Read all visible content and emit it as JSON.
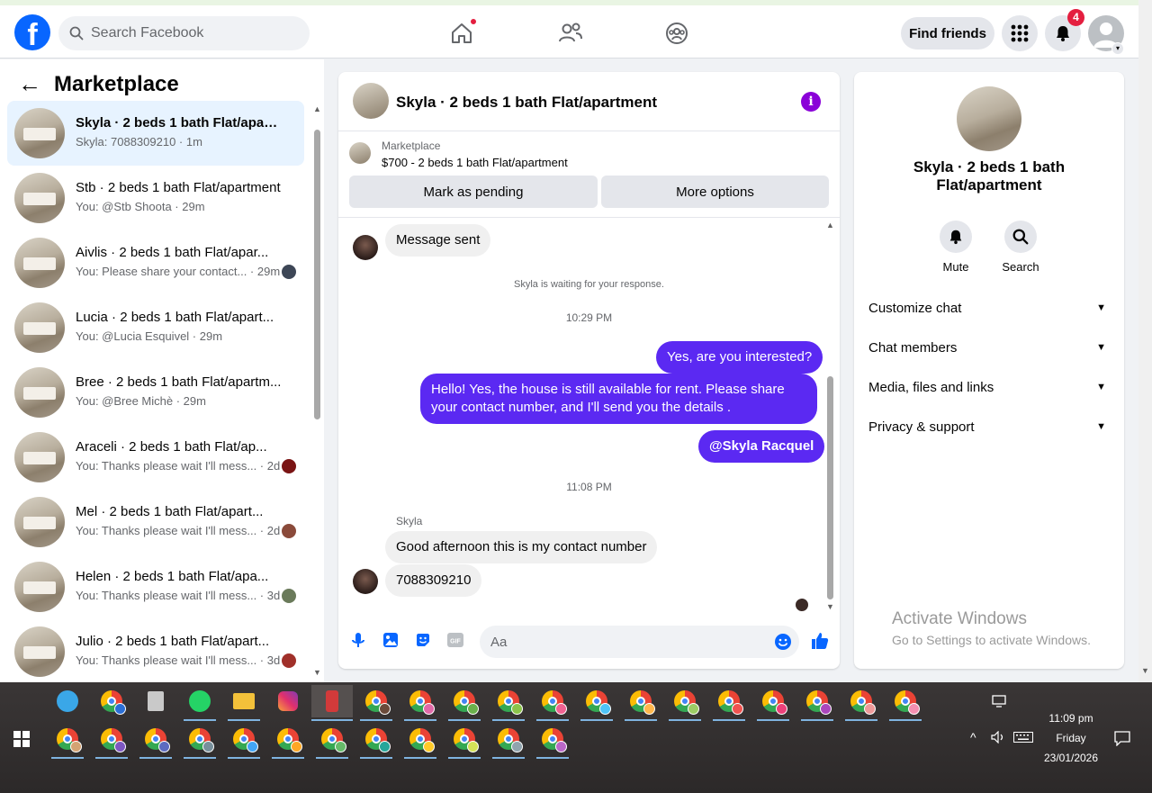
{
  "colors": {
    "brand": "#0866ff",
    "outgoing_bubble": "#5b29f2",
    "info": "#8a01d8",
    "notification": "#e41e3f",
    "active_row": "#e7f3ff"
  },
  "topbar": {
    "search_placeholder": "Search Facebook",
    "find_friends": "Find friends",
    "notification_count": "4",
    "nav_icons": [
      "home-icon",
      "friends-icon",
      "groups-icon"
    ]
  },
  "sidebar": {
    "title": "Marketplace",
    "conversations": [
      {
        "name": "Skyla · 2 beds 1 bath Flat/apart...",
        "sub": "Skyla: 7088309210 · 1m",
        "active": true
      },
      {
        "name": "Stb · 2 beds 1 bath Flat/apartment",
        "sub": "You: @Stb Shoota · 29m"
      },
      {
        "name": "Aivlis · 2 beds 1 bath Flat/apar...",
        "sub": "You: Please share your contact... · 29m"
      },
      {
        "name": "Lucia · 2 beds 1 bath Flat/apart...",
        "sub": "You: @Lucia Esquivel · 29m"
      },
      {
        "name": "Bree · 2 beds 1 bath Flat/apartm...",
        "sub": "You: @Bree Michè · 29m"
      },
      {
        "name": "Araceli · 2 beds 1 bath Flat/ap...",
        "sub": "You: Thanks please wait I'll mess... · 2d"
      },
      {
        "name": "Mel · 2 beds 1 bath Flat/apart...",
        "sub": "You: Thanks please wait I'll mess... · 2d"
      },
      {
        "name": "Helen · 2 beds 1 bath Flat/apa...",
        "sub": "You: Thanks please wait I'll mess... · 3d"
      },
      {
        "name": "Julio · 2 beds 1 bath Flat/apart...",
        "sub": "You: Thanks please wait I'll mess... · 3d"
      }
    ]
  },
  "chat": {
    "title": "Skyla · 2 beds 1 bath Flat/apartment",
    "listing_label": "Marketplace",
    "listing_price": "$700 - 2 beds 1 bath Flat/apartment",
    "mark_pending": "Mark as pending",
    "more_options": "More options",
    "msg_sent": "Message sent",
    "waiting": "Skyla is waiting for your response.",
    "time1": "10:29 PM",
    "out1": "Yes, are you interested?",
    "out2": "Hello! Yes, the house is still available for rent. Please share your contact number, and I'll send you the details .",
    "out3": "@Skyla Racquel",
    "time2": "11:08 PM",
    "sender": "Skyla",
    "in1": "Good afternoon this is my contact number",
    "in2": "7088309210",
    "composer_placeholder": "Aa"
  },
  "details": {
    "title": "Skyla · 2 beds 1 bath Flat/apartment",
    "mute": "Mute",
    "search": "Search",
    "rows": [
      "Customize chat",
      "Chat members",
      "Media, files and links",
      "Privacy & support"
    ]
  },
  "watermark": {
    "line1": "Activate Windows",
    "line2": "Go to Settings to activate Windows."
  },
  "taskbar": {
    "time": "11:09 pm",
    "day": "Friday",
    "date": "23/01/2026"
  }
}
